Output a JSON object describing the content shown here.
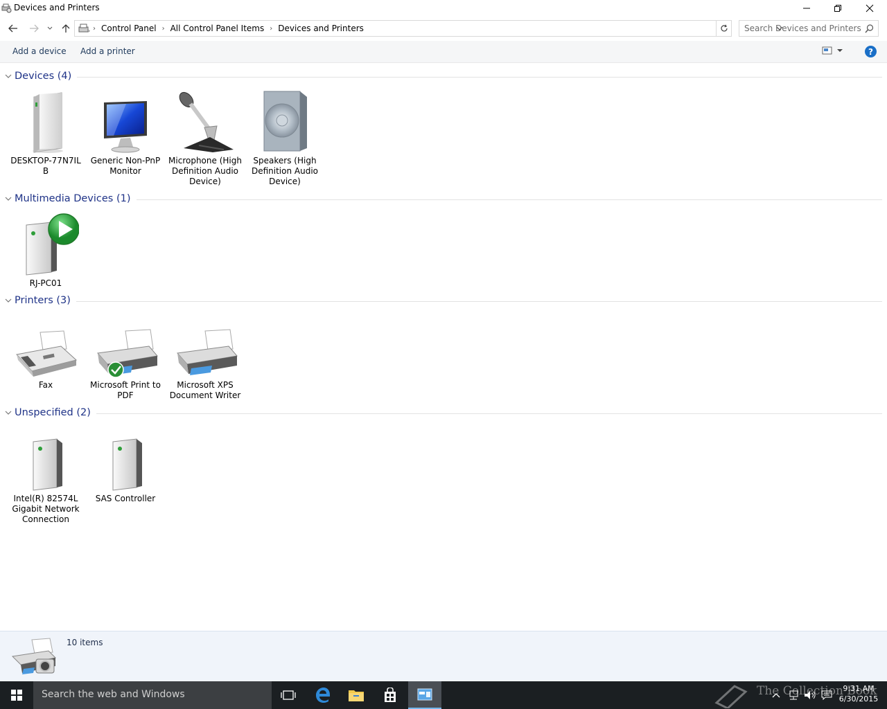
{
  "window": {
    "title": "Devices and Printers"
  },
  "address": {
    "crumbs": [
      "Control Panel",
      "All Control Panel Items",
      "Devices and Printers"
    ],
    "search_placeholder": "Search Devices and Printers"
  },
  "commands": {
    "add_device": "Add a device",
    "add_printer": "Add a printer",
    "help": "?"
  },
  "groups": {
    "devices": {
      "title": "Devices (4)",
      "items": [
        {
          "label": "DESKTOP-77N7IL B",
          "icon": "computer-tower-icon"
        },
        {
          "label": "Generic Non-PnP Monitor",
          "icon": "monitor-icon"
        },
        {
          "label": "Microphone (High Definition Audio Device)",
          "icon": "microphone-icon"
        },
        {
          "label": "Speakers (High Definition Audio Device)",
          "icon": "speaker-icon"
        }
      ]
    },
    "multimedia": {
      "title": "Multimedia Devices (1)",
      "items": [
        {
          "label": "RJ-PC01",
          "icon": "media-server-icon"
        }
      ]
    },
    "printers": {
      "title": "Printers (3)",
      "items": [
        {
          "label": "Fax",
          "icon": "fax-icon"
        },
        {
          "label": "Microsoft Print to PDF",
          "icon": "printer-default-icon"
        },
        {
          "label": "Microsoft XPS Document Writer",
          "icon": "printer-icon"
        }
      ]
    },
    "unspecified": {
      "title": "Unspecified (2)",
      "items": [
        {
          "label": "Intel(R) 82574L Gigabit Network Connection",
          "icon": "device-box-icon"
        },
        {
          "label": "SAS Controller",
          "icon": "device-box-icon"
        }
      ]
    }
  },
  "details": {
    "count": "10 items"
  },
  "taskbar": {
    "search_placeholder": "Search the web and Windows",
    "time": "9:31 AM",
    "date": "6/30/2015",
    "watermark": "The Collection Book"
  },
  "colors": {
    "group_title": "#1e3287",
    "accent": "#1a6fc7",
    "taskbar": "#1b1f22"
  }
}
